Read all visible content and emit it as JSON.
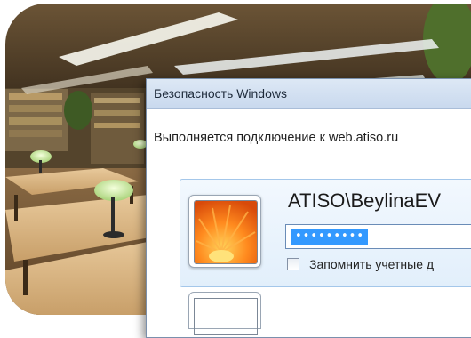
{
  "dialog": {
    "title": "Безопасность Windows",
    "connect_message": "Выполняется подключение к web.atiso.ru",
    "username": "ATISO\\BeylinaEV",
    "password_masked": "•••••••••",
    "remember_label": "Запомнить учетные д"
  },
  "icons": {
    "user_tile": "orange-flower-user-icon",
    "remember": "checkbox-icon"
  },
  "colors": {
    "selection": "#3399ff",
    "tile_border": "#a4c7ea"
  }
}
